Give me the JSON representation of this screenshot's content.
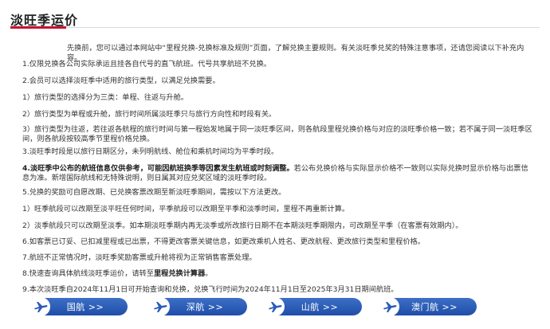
{
  "header": {
    "title": "淡旺季运价"
  },
  "intro": "先换前，您可以通过本网站中“里程兑换-兑换标准及规则”页面，了解兑换主要规则。有关淡旺季兑奖的特殊注意事项，还请您阅读以下补充内容。",
  "items": [
    "1.仅限兑换各公司实际承运且挂各自代号的直飞航班。代号共享航班不兑换。",
    "2.会员可以选择淡旺季中适用的旅行类型，以满足兑换需要。",
    "1）旅行类型的选择分为三类：单程、往返与升舱。",
    "2）旅行类型为单程或升舱，旅行时间所属淡旺季只与旅行方向性和时段有关。",
    "3）旅行类型为往返，若往返各航程的旅行时间与第一程始发地属于同一淡旺季区间，则各航段里程兑换价格与对应的淡旺季价格一致；若不属于同一淡旺季区间，则各航段按较高季节里程价格兑换。",
    "3.淡旺季时段是以旅行日期区分，未列明航线、舱位和乘机时间均为平季时段。"
  ],
  "item4": {
    "prefix": "4.",
    "bold": "淡旺季中公布的航班信息仅供参考，可能因航班换季等因素发生航班或时刻调整。",
    "rest": "若公布兑换价格与实际显示价格不一致则以实际兑换时显示价格与出票信息为准。新增国际航线和无特殊说明，则日属其对应兑奖区域的淡旺季时段。"
  },
  "items2": [
    "5.兑换的奖励可自愿改期、已兑换客票改期至新淡旺季期间，需按以下方法更改。",
    "1）旺季航段可以改期至淡平旺任何时间，平季航段可以改期至平季和淡季时间，里程不再重新计算。",
    "2）淡季航段只可以改期至淡季。如本期淡旺季期内再无淡季或所改旅行日期不在本期淡旺季期限内，可改期至平季（在客票有效期内）。",
    "6.如客票已订妥、已扣减里程或已出票，不得更改客票关键信息，如更改乘机人姓名、更改航程、更改旅行类型和里程价格。",
    "7.航班不正常情况时，淡旺季奖励客票或升舱将视为正常销售客票处理。",
    "8.快速查询具体航线淡旺季运价，请转至里程兑换计算器。",
    "9.本次淡旺季自2024年11月1日可开始查询和兑换，兑换飞行时间为2024年11月1日至2025年3月31日期间航班。"
  ],
  "item8": {
    "text": "8.快速查询具体航线淡旺季运价，请转至",
    "link": "里程兑换计算器",
    "tail": "。"
  },
  "buttons": [
    {
      "label": "国航 >>",
      "icon": "airplane-icon"
    },
    {
      "label": "深航 >>",
      "icon": "airplane-icon"
    },
    {
      "label": "山航 >>",
      "icon": "airplane-icon"
    },
    {
      "label": "澳门航 >>",
      "icon": "airplane-icon"
    }
  ],
  "colors": {
    "accent": "#c8102e",
    "button": "#2a5cb8"
  }
}
